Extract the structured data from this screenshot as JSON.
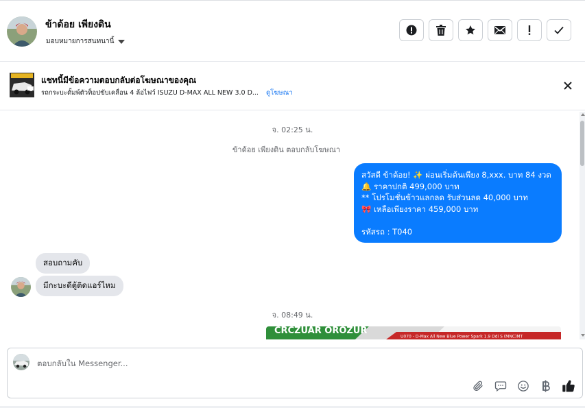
{
  "header": {
    "name": "ข้าด้อย เพียงดิน",
    "assign_label": "มอบหมายการสนทนานี้"
  },
  "actions": [
    "report-icon",
    "trash-icon",
    "star-icon",
    "envelope-icon",
    "exclamation-icon",
    "check-icon"
  ],
  "ad": {
    "title": "แชทนี้มีข้อความตอบกลับต่อโฆษณาของคุณ",
    "subtitle": "รถกระบะดั้มพ์ตัวท็อปขับเคลื่อน 4 ล้อไฟว์ ISUZU D-MAX ALL NEW 3.0 D...",
    "link": "ดูโฆษณา"
  },
  "conversation": {
    "timestamp_1": "จ. 02:25 น.",
    "system_note": "ข้าด้อย เพียงดิน ตอบกลับโฆษณา",
    "outgoing_lines": [
      "สวัสดี ข้าด้อย! ✨  ผ่อนเริ่มต้นเพียง 8,xxx. บาท 84 งวด",
      "🔔 ราคาปกติ 499,000 บาท",
      "** โปรโมชั่นข้าวแลกลด รับส่วนลด 40,000 บาท",
      "🎀  เหลือเพียงราคา 459,000 บาท",
      "",
      " รหัสรถ : T040"
    ],
    "incoming": [
      "สอบถามคับ",
      "มีกะบะดีตู้ติดแอร์ไหม"
    ],
    "timestamp_2": "จ. 08:49 น.",
    "image_caption": "U070 - D-Max All New Blue Power Spark 1.9 Ddi S (MNC)MT"
  },
  "composer": {
    "placeholder": "ตอบกลับใน Messenger..."
  },
  "colors": {
    "accent": "#0a7cff",
    "incoming_bubble": "#e4e6eb",
    "border": "#ccd0d5"
  }
}
